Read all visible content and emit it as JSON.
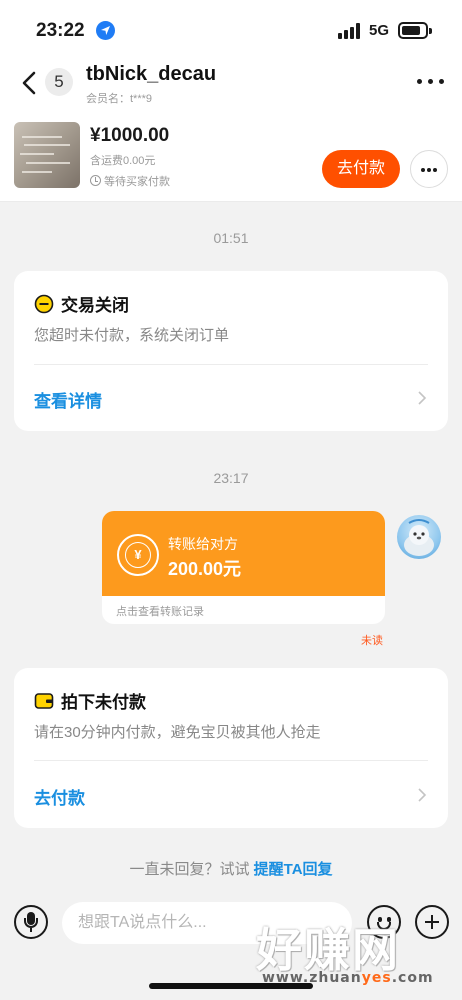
{
  "status_bar": {
    "time": "23:22",
    "network": "5G"
  },
  "header": {
    "back_badge": "5",
    "title": "tbNick_decau",
    "subtitle": "会员名：t***9"
  },
  "product": {
    "price": "¥1000.00",
    "shipping": "含运费0.00元",
    "status": "等待买家付款",
    "pay_button": "去付款"
  },
  "chat": {
    "messages": [
      {
        "timestamp": "01:51"
      },
      {
        "type": "system-card",
        "title": "交易关闭",
        "description": "您超时未付款，系统关闭订单",
        "link": "查看详情"
      },
      {
        "timestamp": "23:17"
      },
      {
        "type": "transfer",
        "title": "转账给对方",
        "amount": "200.00元",
        "footer": "点击查看转账记录",
        "read_status": "未读",
        "icon_symbol": "¥"
      },
      {
        "type": "system-card",
        "title": "拍下未付款",
        "description": "请在30分钟内付款，避免宝贝被其他人抢走",
        "link": "去付款"
      }
    ],
    "reminder_prefix": "一直未回复？试试",
    "reminder_link": "提醒TA回复"
  },
  "input": {
    "placeholder": "想跟TA说点什么..."
  },
  "watermark": {
    "brand": "好赚网",
    "url_prefix": "www.zhuan",
    "url_highlight": "yes",
    "url_suffix": ".com"
  },
  "colors": {
    "accent_orange": "#ff5000",
    "transfer_orange": "#fd9a1d",
    "link_blue": "#1a8fe0",
    "close_icon_yellow": "#ffd300",
    "unread_red": "#ff5a1f"
  }
}
